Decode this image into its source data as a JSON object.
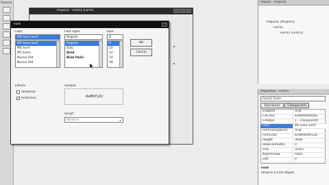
{
  "toolbox": {
    "title": "General"
  },
  "form_window": {
    "title": "Project1 - Form1 (Form)"
  },
  "font_dialog": {
    "title": "Font",
    "font_label": "Font:",
    "font_value": "MS Sans Serif",
    "fonts": [
      "MS Sans Serif",
      "MS Serif",
      "MT Extra",
      "Nueva Std",
      "Nueva Std"
    ],
    "style_label": "Font style:",
    "style_value": "Regular",
    "styles": [
      "Regular",
      "Italic",
      "Bold",
      "Bold Italic"
    ],
    "size_label": "Size:",
    "size_value": "8",
    "sizes": [
      "8",
      "10",
      "12",
      "14",
      "18",
      "24"
    ],
    "ok": "OK",
    "cancel": "Cancel",
    "effects_label": "Effects",
    "strikeout": "Strikeout",
    "underline": "Underline",
    "sample_label": "Sample",
    "sample_text": "AaBbYyZz",
    "script_label": "Script:",
    "script_value": "Western"
  },
  "project_pane": {
    "title": "Project - Project1",
    "tree": [
      "Project1 (Project1)",
      "Forms",
      "Form1 (Form1)"
    ]
  },
  "props_pane": {
    "title": "Properties - Form1",
    "object": "Form1 Form",
    "tabs": [
      "Alphabetic",
      "Categorized"
    ],
    "rows": [
      {
        "k": "Enabled",
        "v": "True"
      },
      {
        "k": "FillColor",
        "v": "&H00000000&"
      },
      {
        "k": "FillStyle",
        "v": "1 - Transparent"
      },
      {
        "k": "Font",
        "v": "MS Sans Serif"
      },
      {
        "k": "FontTransparent",
        "v": "True"
      },
      {
        "k": "ForeColor",
        "v": "&H80000012&"
      },
      {
        "k": "Height",
        "v": "3600"
      },
      {
        "k": "HelpContextID",
        "v": "0"
      },
      {
        "k": "Icon",
        "v": "(Icon)"
      },
      {
        "k": "KeyPreview",
        "v": "False"
      },
      {
        "k": "Left",
        "v": "0"
      }
    ],
    "desc_title": "Font",
    "desc_text": "Returns a Font object."
  }
}
